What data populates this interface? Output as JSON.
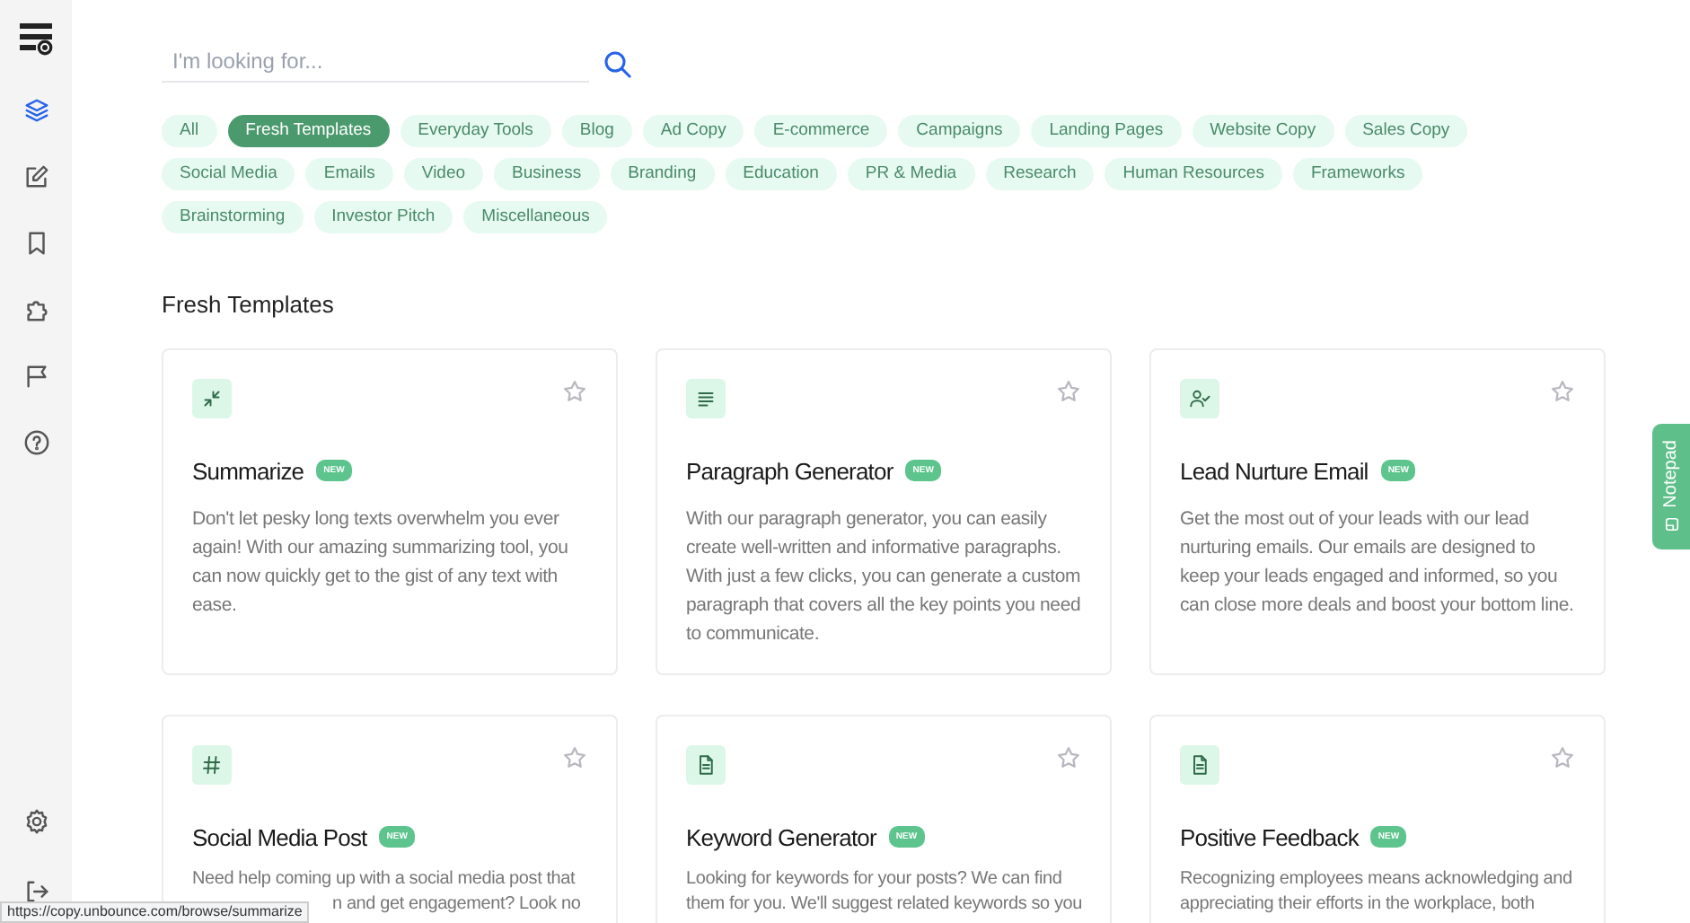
{
  "sidebar": {
    "top": [
      {
        "selected": true
      },
      {
        "selected": false
      },
      {
        "selected": false
      },
      {
        "selected": false
      },
      {
        "selected": false
      },
      {
        "selected": false
      }
    ],
    "bottom": [
      {
        "selected": false
      },
      {
        "selected": false
      }
    ]
  },
  "search": {
    "placeholder": "I'm looking for..."
  },
  "chip_rows": [
    [
      {
        "label": "All",
        "selected": false
      },
      {
        "label": "Fresh Templates",
        "selected": true
      },
      {
        "label": "Everyday Tools",
        "selected": false
      },
      {
        "label": "Blog",
        "selected": false
      },
      {
        "label": "Ad Copy",
        "selected": false
      },
      {
        "label": "E-commerce",
        "selected": false
      },
      {
        "label": "Campaigns",
        "selected": false
      },
      {
        "label": "Landing Pages",
        "selected": false
      },
      {
        "label": "Website Copy",
        "selected": false
      },
      {
        "label": "Sales Copy",
        "selected": false
      }
    ],
    [
      {
        "label": "Social Media",
        "selected": false
      },
      {
        "label": "Emails",
        "selected": false
      },
      {
        "label": "Video",
        "selected": false
      },
      {
        "label": "Business",
        "selected": false
      },
      {
        "label": "Branding",
        "selected": false
      },
      {
        "label": "Education",
        "selected": false
      },
      {
        "label": "PR & Media",
        "selected": false
      },
      {
        "label": "Research",
        "selected": false
      },
      {
        "label": "Human Resources",
        "selected": false
      },
      {
        "label": "Frameworks",
        "selected": false
      }
    ],
    [
      {
        "label": "Brainstorming",
        "selected": false
      },
      {
        "label": "Investor Pitch",
        "selected": false
      },
      {
        "label": "Miscellaneous",
        "selected": false
      }
    ]
  ],
  "section_title": "Fresh Templates",
  "cards": [
    {
      "title": "Summarize",
      "badge": "NEW",
      "description": "Don't let pesky long texts overwhelm you ever again! With our amazing summarizing tool, you can now quickly get to the gist of any text with ease."
    },
    {
      "title": "Paragraph Generator",
      "badge": "NEW",
      "description": "With our paragraph generator, you can easily create well-written and informative paragraphs. With just a few clicks, you can generate a custom paragraph that covers all the key points you need to communicate."
    },
    {
      "title": "Lead Nurture Email",
      "badge": "NEW",
      "description": "Get the most out of your leads with our lead nurturing emails. Our emails are designed to keep your leads engaged and informed, so you can close more deals and boost your bottom line."
    },
    {
      "title": "Social Media Post",
      "badge": "NEW",
      "description_lines": [
        "Need help coming up with a social media post that",
        "n and get engagement? Look no"
      ]
    },
    {
      "kind": "document",
      "title": "Keyword Generator",
      "badge": "NEW",
      "description_lines": [
        "Looking for keywords for your posts? We can find",
        "them for you. We'll suggest related keywords so you"
      ]
    },
    {
      "kind": "document",
      "title": "Positive Feedback",
      "badge": "NEW",
      "description_lines": [
        "Recognizing employees means acknowledging and",
        "appreciating their efforts in the workplace, both"
      ]
    }
  ],
  "notepad": {
    "label": "Notepad"
  },
  "status_url": "https://copy.unbounce.com/browse/summarize"
}
